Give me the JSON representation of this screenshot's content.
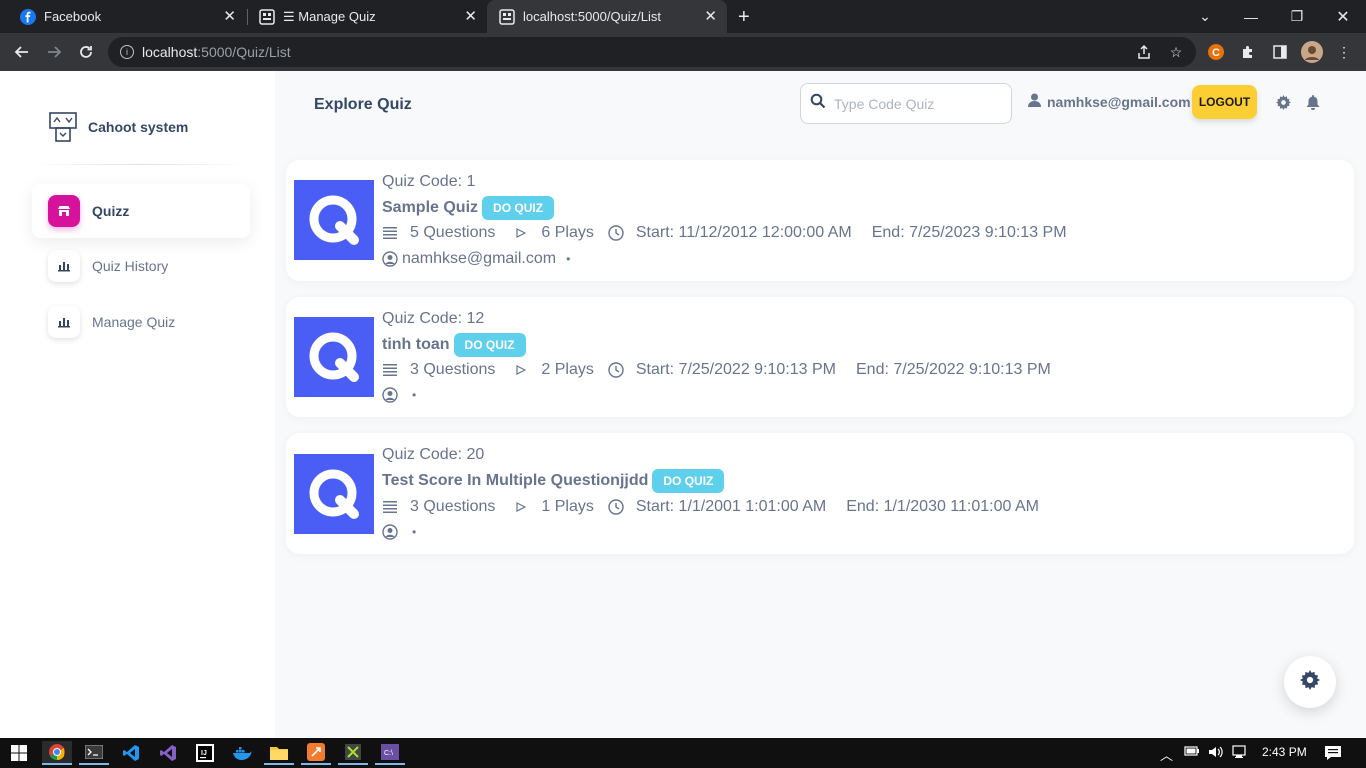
{
  "browser": {
    "tabs": [
      {
        "label": "Facebook"
      },
      {
        "label": "☰ Manage Quiz"
      },
      {
        "label": "localhost:5000/Quiz/List"
      }
    ],
    "url_host": "localhost",
    "url_path": ":5000/Quiz/List"
  },
  "brand": {
    "name": "Cahoot system"
  },
  "sidebar": {
    "items": [
      {
        "label": "Quizz",
        "active": true
      },
      {
        "label": "Quiz History",
        "active": false
      },
      {
        "label": "Manage Quiz",
        "active": false
      }
    ]
  },
  "header": {
    "title": "Explore Quiz",
    "search_placeholder": "Type Code Quiz",
    "user_email": "namhkse@gmail.com!",
    "logout_label": "LOGOUT"
  },
  "quizzes": [
    {
      "code": "Quiz Code: 1",
      "title": "Sample Quiz",
      "action": "DO QUIZ",
      "questions": "5 Questions",
      "plays": "6 Plays",
      "start": "Start: 11/12/2012 12:00:00 AM",
      "end": "End: 7/25/2023 9:10:13 PM",
      "author": "namhkse@gmail.com",
      "dot": "•"
    },
    {
      "code": "Quiz Code: 12",
      "title": "tinh toan",
      "action": "DO QUIZ",
      "questions": "3 Questions",
      "plays": "2 Plays",
      "start": "Start: 7/25/2022 9:10:13 PM",
      "end": "End: 7/25/2022 9:10:13 PM",
      "author": "",
      "dot": "•"
    },
    {
      "code": "Quiz Code: 20",
      "title": "Test Score In Multiple Questionjjdd",
      "action": "DO QUIZ",
      "questions": "3 Questions",
      "plays": "1 Plays",
      "start": "Start: 1/1/2001 1:01:00 AM",
      "end": "End: 1/1/2030 11:01:00 AM",
      "author": "",
      "dot": "•"
    }
  ],
  "taskbar": {
    "time": "2:43 PM"
  },
  "colors": {
    "accent": "#d6119c",
    "quiz_logo": "#4a5ef5",
    "do_quiz": "#5fd0ec",
    "logout": "#fbcf33",
    "text": "#67748e"
  },
  "icons": [
    "facebook-icon",
    "quiz-tab-icon",
    "search-icon",
    "user-icon",
    "gear-icon",
    "bell-icon",
    "list-icon",
    "play-icon",
    "clock-icon",
    "user-circle-icon",
    "shop-icon",
    "chart-icon"
  ]
}
